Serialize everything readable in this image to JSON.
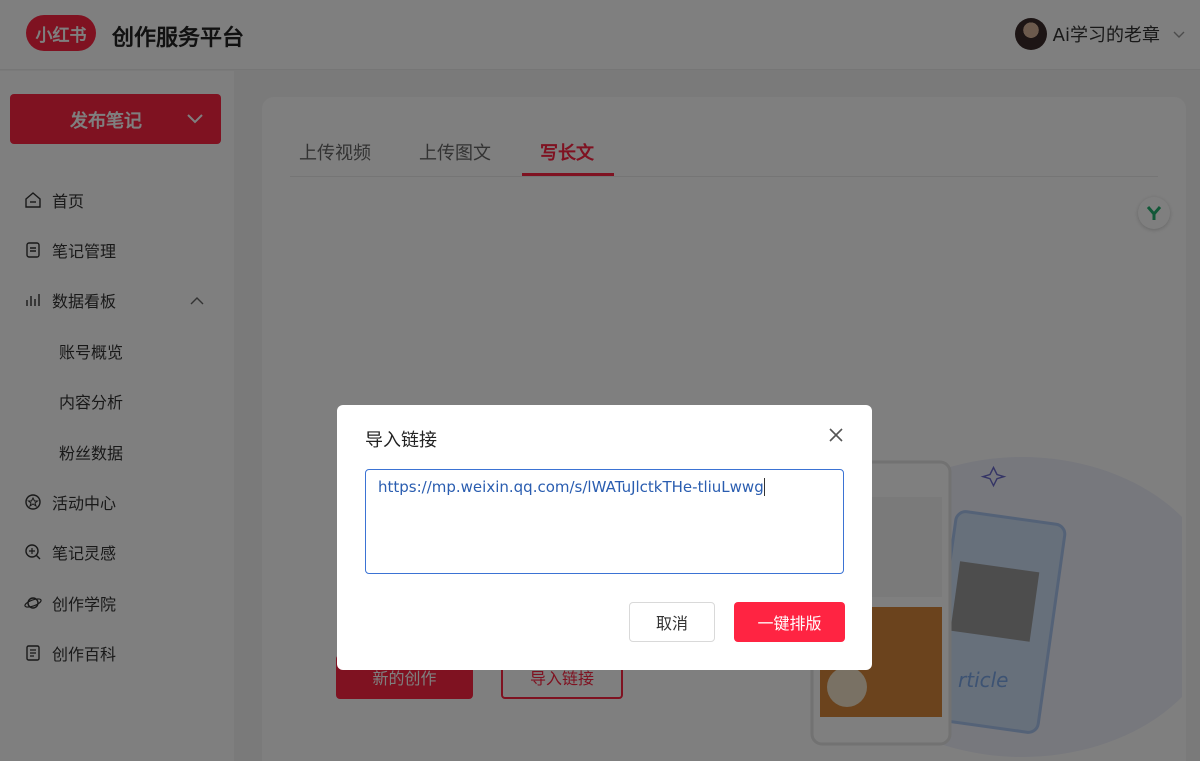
{
  "header": {
    "logo_text": "小红书",
    "app_title": "创作服务平台",
    "user_name": "Ai学习的老章"
  },
  "sidebar": {
    "publish_label": "发布笔记",
    "items": [
      {
        "label": "首页",
        "icon": "home-icon"
      },
      {
        "label": "笔记管理",
        "icon": "note-icon"
      },
      {
        "label": "数据看板",
        "icon": "chart-icon"
      },
      {
        "label": "活动中心",
        "icon": "activity-icon"
      },
      {
        "label": "笔记灵感",
        "icon": "inspiration-icon"
      },
      {
        "label": "创作学院",
        "icon": "academy-icon"
      },
      {
        "label": "创作百科",
        "icon": "wiki-icon"
      }
    ],
    "sub_items": [
      "账号概览",
      "内容分析",
      "粉丝数据"
    ]
  },
  "main": {
    "tabs": [
      {
        "label": "上传视频",
        "active": false
      },
      {
        "label": "上传图文",
        "active": false
      },
      {
        "label": "写长文",
        "active": true
      }
    ],
    "new_button": "新的创作",
    "import_button": "导入链接",
    "illustration_text": "rticle"
  },
  "dialog": {
    "title": "导入链接",
    "url_value": "https://mp.weixin.qq.com/s/lWATuJlctkTHe-tliuLwwg",
    "cancel_label": "取消",
    "submit_label": "一键排版"
  },
  "colors": {
    "accent": "#ff2442",
    "input_border": "#3b73d4"
  }
}
